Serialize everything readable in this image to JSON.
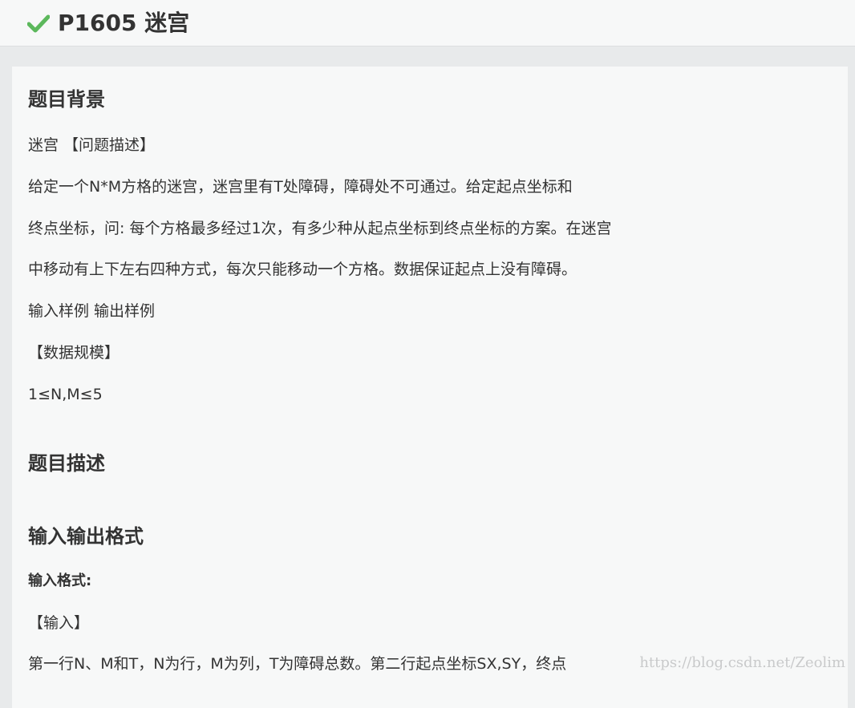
{
  "header": {
    "check_icon": "check-icon",
    "title": "P1605 迷宫"
  },
  "content": {
    "background": {
      "heading": "题目背景",
      "paragraphs": [
        "迷宫 【问题描述】",
        "给定一个N*M方格的迷宫，迷宫里有T处障碍，障碍处不可通过。给定起点坐标和",
        "终点坐标，问: 每个方格最多经过1次，有多少种从起点坐标到终点坐标的方案。在迷宫",
        "中移动有上下左右四种方式，每次只能移动一个方格。数据保证起点上没有障碍。",
        "输入样例 输出样例",
        "【数据规模】",
        "1≤N,M≤5"
      ]
    },
    "description": {
      "heading": "题目描述"
    },
    "io_format": {
      "heading": "输入输出格式",
      "input_label": "输入格式:",
      "paragraphs": [
        "【输入】",
        "第一行N、M和T，N为行，M为列，T为障碍总数。第二行起点坐标SX,SY，终点"
      ]
    }
  },
  "watermark": "https://blog.csdn.net/Zeolim",
  "colors": {
    "check": "#5cb85c",
    "text": "#333333",
    "page_bg": "#e8eaeb",
    "card_bg": "#f7f8f8"
  }
}
